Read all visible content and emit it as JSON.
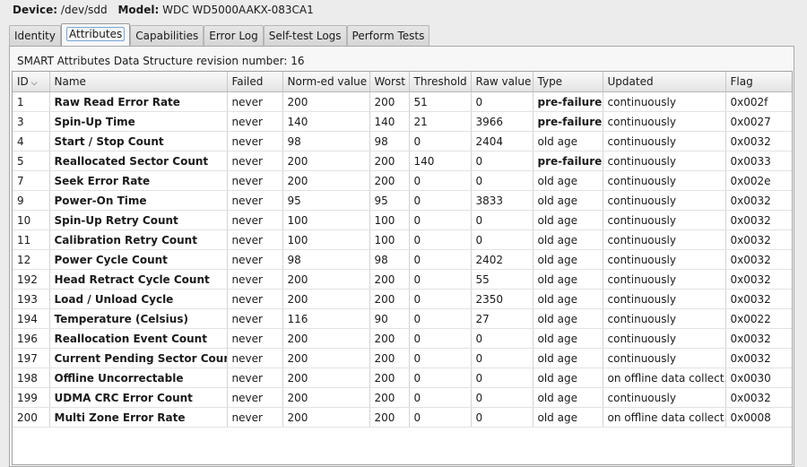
{
  "device": {
    "device_label": "Device:",
    "device_value": "/dev/sdd",
    "model_label": "Model:",
    "model_value": "WDC WD5000AAKX-083CA1"
  },
  "tabs": [
    {
      "label": "Identity"
    },
    {
      "label": "Attributes"
    },
    {
      "label": "Capabilities"
    },
    {
      "label": "Error Log"
    },
    {
      "label": "Self-test Logs"
    },
    {
      "label": "Perform Tests"
    }
  ],
  "revision_text": "SMART Attributes Data Structure revision number: 16",
  "columns": [
    "ID",
    "Name",
    "Failed",
    "Norm-ed value",
    "Worst",
    "Threshold",
    "Raw value",
    "Type",
    "Updated",
    "Flag"
  ],
  "rows": [
    [
      "1",
      "Raw Read Error Rate",
      "never",
      "200",
      "200",
      "51",
      "0",
      "pre-failure",
      "continuously",
      "0x002f"
    ],
    [
      "3",
      "Spin-Up Time",
      "never",
      "140",
      "140",
      "21",
      "3966",
      "pre-failure",
      "continuously",
      "0x0027"
    ],
    [
      "4",
      "Start / Stop Count",
      "never",
      "98",
      "98",
      "0",
      "2404",
      "old age",
      "continuously",
      "0x0032"
    ],
    [
      "5",
      "Reallocated Sector Count",
      "never",
      "200",
      "200",
      "140",
      "0",
      "pre-failure",
      "continuously",
      "0x0033"
    ],
    [
      "7",
      "Seek Error Rate",
      "never",
      "200",
      "200",
      "0",
      "0",
      "old age",
      "continuously",
      "0x002e"
    ],
    [
      "9",
      "Power-On Time",
      "never",
      "95",
      "95",
      "0",
      "3833",
      "old age",
      "continuously",
      "0x0032"
    ],
    [
      "10",
      "Spin-Up Retry Count",
      "never",
      "100",
      "100",
      "0",
      "0",
      "old age",
      "continuously",
      "0x0032"
    ],
    [
      "11",
      "Calibration Retry Count",
      "never",
      "100",
      "100",
      "0",
      "0",
      "old age",
      "continuously",
      "0x0032"
    ],
    [
      "12",
      "Power Cycle Count",
      "never",
      "98",
      "98",
      "0",
      "2402",
      "old age",
      "continuously",
      "0x0032"
    ],
    [
      "192",
      "Head Retract Cycle Count",
      "never",
      "200",
      "200",
      "0",
      "55",
      "old age",
      "continuously",
      "0x0032"
    ],
    [
      "193",
      "Load / Unload Cycle",
      "never",
      "200",
      "200",
      "0",
      "2350",
      "old age",
      "continuously",
      "0x0032"
    ],
    [
      "194",
      "Temperature (Celsius)",
      "never",
      "116",
      "90",
      "0",
      "27",
      "old age",
      "continuously",
      "0x0022"
    ],
    [
      "196",
      "Reallocation Event Count",
      "never",
      "200",
      "200",
      "0",
      "0",
      "old age",
      "continuously",
      "0x0032"
    ],
    [
      "197",
      "Current Pending Sector Count",
      "never",
      "200",
      "200",
      "0",
      "0",
      "old age",
      "continuously",
      "0x0032"
    ],
    [
      "198",
      "Offline Uncorrectable",
      "never",
      "200",
      "200",
      "0",
      "0",
      "old age",
      "on offline data collect.",
      "0x0030"
    ],
    [
      "199",
      "UDMA CRC Error Count",
      "never",
      "200",
      "200",
      "0",
      "0",
      "old age",
      "continuously",
      "0x0032"
    ],
    [
      "200",
      "Multi Zone Error Rate",
      "never",
      "200",
      "200",
      "0",
      "0",
      "old age",
      "on offline data collect.",
      "0x0008"
    ]
  ],
  "icons": {
    "sort": "chevron-down-icon"
  }
}
